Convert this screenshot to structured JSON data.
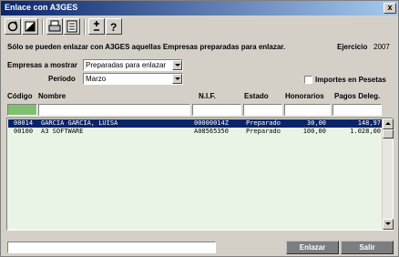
{
  "window": {
    "title": "Enlace con A3GES",
    "close_label": "x"
  },
  "toolbar": {
    "icons": [
      "refresh-icon",
      "contrast-icon",
      "print-icon",
      "list-icon",
      "add-remove-icon",
      "help-icon"
    ]
  },
  "message": "Sólo se pueden enlazar con A3GES aquellas Empresas preparadas para enlazar.",
  "ejercicio": {
    "label": "Ejercicio",
    "value": "2007"
  },
  "filters": {
    "empresas_label": "Empresas a mostrar",
    "empresas_value": "Preparadas para enlazar",
    "periodo_label": "Período",
    "periodo_value": "Marzo",
    "importes_label": "Importes en Pesetas",
    "importes_checked": false
  },
  "table": {
    "columns": [
      "Código",
      "Nombre",
      "N.I.F.",
      "Estado",
      "Honorarios",
      "Pagos Deleg."
    ],
    "rows": [
      {
        "codigo": "00014",
        "nombre": "GARCIA GARCIA, LUISA",
        "nif": "00000014Z",
        "estado": "Preparado",
        "honorarios": "30,00",
        "pagos": "148,97"
      },
      {
        "codigo": "00100",
        "nombre": "A3 SOFTWARE",
        "nif": "A08565350",
        "estado": "Preparado",
        "honorarios": "100,00",
        "pagos": "1.028,00"
      }
    ],
    "selected_row": 0
  },
  "buttons": {
    "enlazar": "Enlazar",
    "salir": "Salir"
  },
  "colors": {
    "title_start": "#0a246a",
    "title_end": "#a6caf0",
    "grid_bg": "#eaf4e6",
    "selection": "#0a246a"
  }
}
